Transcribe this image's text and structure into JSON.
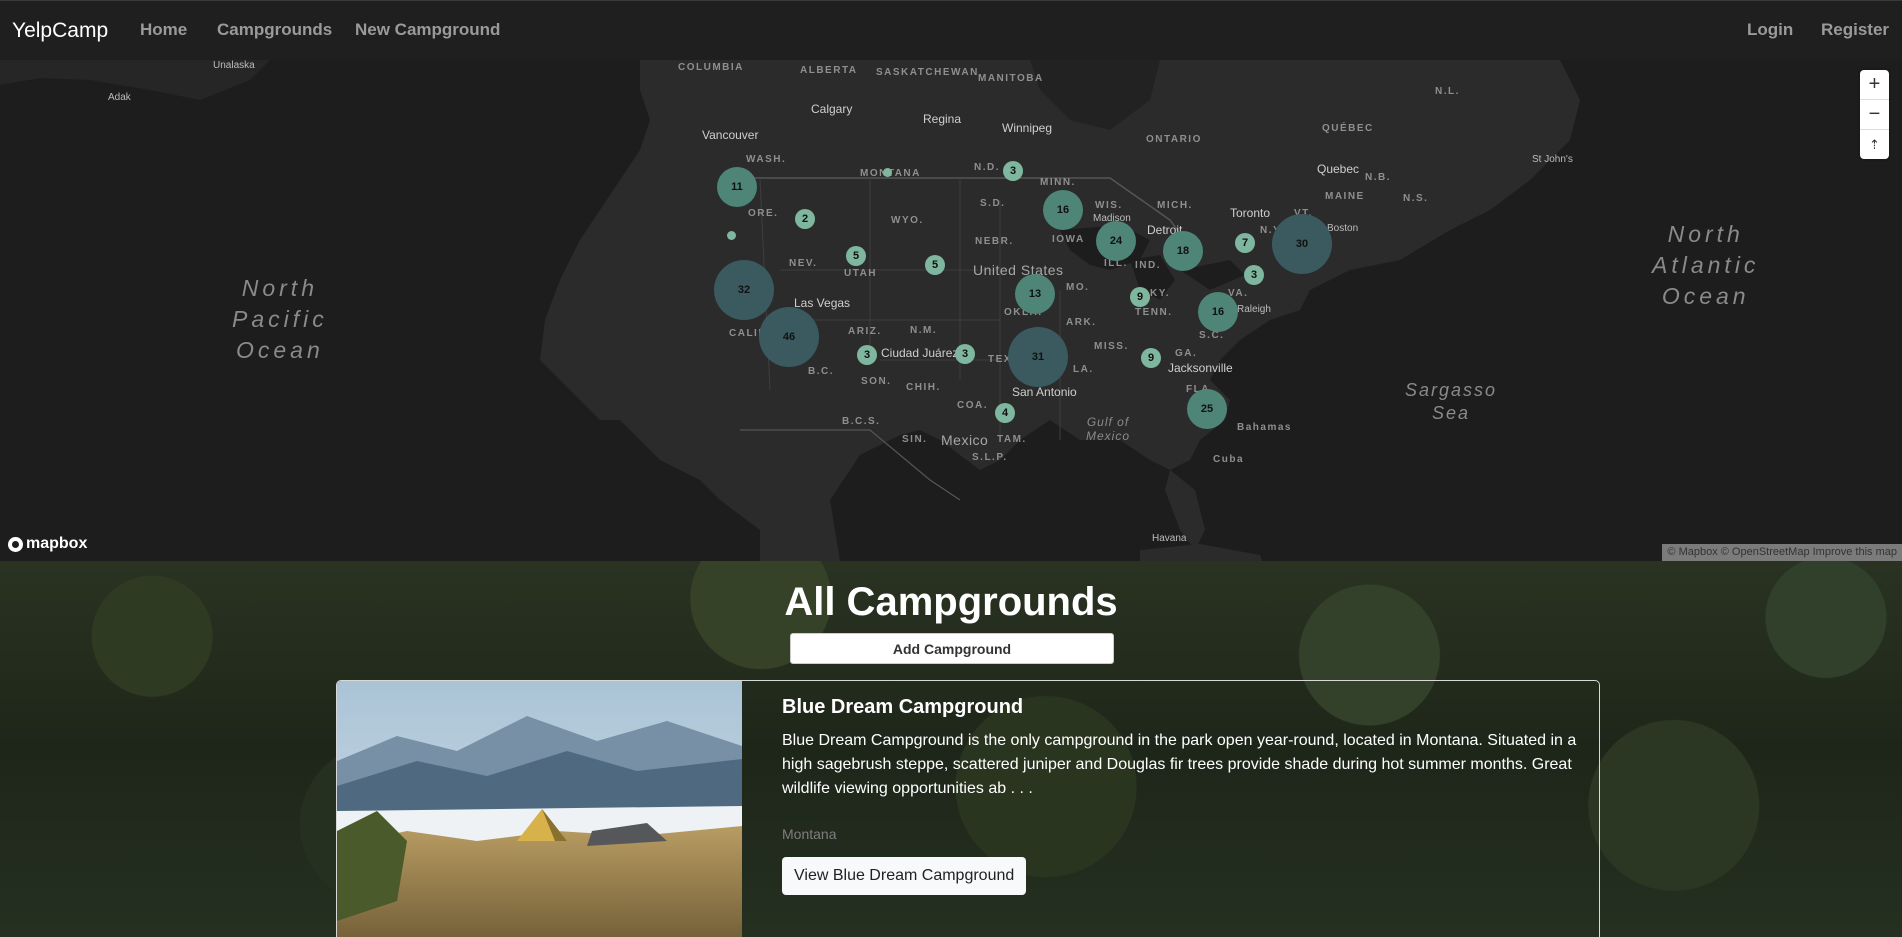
{
  "nav": {
    "brand": "YelpCamp",
    "links": [
      "Home",
      "Campgrounds",
      "New Campground"
    ],
    "login": "Login",
    "register": "Register"
  },
  "map": {
    "oceans": {
      "north_pacific": "North\nPacific\nOcean",
      "north_atlantic": "North\nAtlantic\nOcean",
      "sargasso": "Sargasso\nSea",
      "gulf": "Gulf of\nMexico"
    },
    "cities": {
      "unalaska": "Unalaska",
      "adak": "Adak",
      "calgary": "Calgary",
      "vancouver": "Vancouver",
      "regina": "Regina",
      "winnipeg": "Winnipeg",
      "quebec": "Quebec",
      "st_johns": "St John's",
      "madison": "Madison",
      "detroit": "Detroit",
      "toronto": "Toronto",
      "boston": "Boston",
      "las_vegas": "Las Vegas",
      "ciudad_juarez": "Ciudad Juárez",
      "raleigh": "Raleigh",
      "san_antonio": "San Antonio",
      "jacksonville": "Jacksonville",
      "havana": "Havana"
    },
    "regions": {
      "columbia": "COLUMBIA",
      "alberta": "ALBERTA",
      "saskatchewan": "SASKATCHEWAN",
      "manitoba": "MANITOBA",
      "ontario": "ONTARIO",
      "quebec": "QUÉBEC",
      "nl": "N.L.",
      "nb": "N.B.",
      "ns": "N.S.",
      "wash": "WASH.",
      "montana": "MONTANA",
      "nd": "N.D.",
      "minn": "MINN.",
      "ore": "ORE.",
      "wyo": "WYO.",
      "sd": "S.D.",
      "wis": "WIS.",
      "mich": "MICH.",
      "vt": "VT.",
      "maine": "MAINE",
      "ny": "N.Y.",
      "nev": "NEV.",
      "utah": "UTAH",
      "nebr": "NEBR.",
      "iowa": "IOWA",
      "ill": "ILL.",
      "ind": "IND.",
      "calif": "CALIF.",
      "mo": "MO.",
      "ky": "KY.",
      "va": "VA.",
      "ariz": "ARIZ.",
      "nm": "N.M.",
      "okla": "OKLA.",
      "ark": "ARK.",
      "tenn": "TENN.",
      "sc": "S.C.",
      "tex": "TEX.",
      "miss": "MISS.",
      "ga": "GA.",
      "la": "LA.",
      "fla": "FLA.",
      "bc": "B.C.",
      "son": "SON.",
      "chih": "CHIH.",
      "coa": "COA.",
      "bcs": "B.C.S.",
      "sin": "SIN.",
      "tam": "TAM.",
      "slp": "S.L.P.",
      "bahamas": "Bahamas",
      "cuba": "Cuba",
      "united_states": "United States",
      "mexico": "Mexico"
    },
    "clusters": [
      "11",
      "2",
      "3",
      "16",
      "24",
      "18",
      "7",
      "30",
      "5",
      "5",
      "13",
      "9",
      "3",
      "32",
      "46",
      "3",
      "3",
      "16",
      "31",
      "9",
      "4",
      "25"
    ],
    "controls": {
      "zoom_in": "+",
      "zoom_out": "−",
      "compass": "⇡"
    },
    "logo": "mapbox",
    "attribution": "© Mapbox © OpenStreetMap Improve this map"
  },
  "main": {
    "title": "All Campgrounds",
    "add_button": "Add Campground"
  },
  "campground": {
    "title": "Blue Dream Campground",
    "description": "Blue Dream Campground is the only campground in the park open year-round, located in Montana. Situated in a high sagebrush steppe, scattered juniper and Douglas fir trees provide shade during hot summer months. Great wildlife viewing opportunities ab . . .",
    "location": "Montana",
    "view_button": "View Blue Dream Campground"
  },
  "colors": {
    "cluster_small": "#7fb6a0",
    "cluster_medium": "#4e8577",
    "cluster_large": "#3b5a60",
    "navbar": "#1f1f1f",
    "map_land": "#2b2b2b",
    "map_water": "#1d1d1d"
  }
}
